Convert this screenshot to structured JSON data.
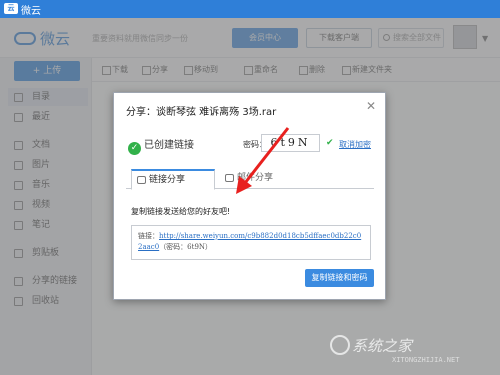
{
  "app": {
    "title": "微云",
    "logo_text": "云"
  },
  "header": {
    "brand": "微云",
    "slogan": "重要资料就用微信同步一份",
    "vip_button": "会员中心",
    "pc_button": "下载客户端",
    "search_placeholder": "搜索全部文件"
  },
  "sidebar": {
    "upload": "+ 上传",
    "items": [
      "目录",
      "最近",
      "文档",
      "图片",
      "音乐",
      "视频",
      "笔记",
      "剪贴板",
      "分享的链接",
      "回收站"
    ]
  },
  "toolbar": {
    "items": [
      "下载",
      "分享",
      "移动到",
      "重命名",
      "删除",
      "新建文件夹"
    ]
  },
  "dialog": {
    "title": "分享：谈断琴弦 难诉离殇 3场.rar",
    "status": "已创建链接",
    "password_label": "密码：",
    "password": "6t9N",
    "cancel_encrypt": "取消加密",
    "tabs": [
      "链接分享",
      "邮件分享"
    ],
    "tip": "复制链接发送给您的好友吧!",
    "link_prefix": "链接：",
    "link_url": "http://share.weiyun.com/c9b882d0d18cb5dffaec0db22c02aac0",
    "link_suffix": "（密码：6t9N）",
    "copy_button": "复制链接和密码"
  },
  "watermark": {
    "text": "系统之家",
    "sub": "XITONGZHIJIA.NET"
  },
  "colors": {
    "accent": "#3b8be0",
    "success": "#32b14a",
    "arrow": "#e8201e"
  },
  "icons": {
    "check": "check-circle-icon",
    "close": "close-icon",
    "link": "link-icon",
    "mail": "mail-icon"
  }
}
